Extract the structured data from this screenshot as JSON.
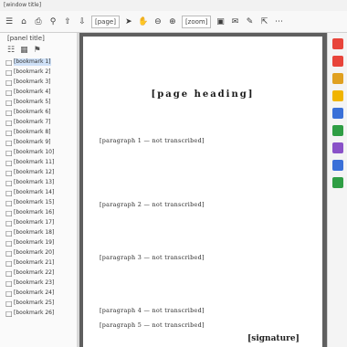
{
  "menubar": {
    "title": "[window title]"
  },
  "toolbar": {
    "page_indicator": "[page]",
    "zoom": "[zoom]",
    "icons": [
      "menu-icon",
      "home-icon",
      "print-icon",
      "search-icon",
      "page-up-icon",
      "page-down-icon",
      "select-icon",
      "hand-icon",
      "zoom-out-icon",
      "zoom-in-icon",
      "fit-icon",
      "comment-icon",
      "pen-icon",
      "share-icon",
      "more-icon"
    ]
  },
  "sidebar": {
    "header": "[panel title]",
    "items": [
      {
        "label": "[bookmark 1]"
      },
      {
        "label": "[bookmark 2]"
      },
      {
        "label": "[bookmark 3]"
      },
      {
        "label": "[bookmark 4]"
      },
      {
        "label": "[bookmark 5]"
      },
      {
        "label": "[bookmark 6]"
      },
      {
        "label": "[bookmark 7]"
      },
      {
        "label": "[bookmark 8]"
      },
      {
        "label": "[bookmark 9]"
      },
      {
        "label": "[bookmark 10]"
      },
      {
        "label": "[bookmark 11]"
      },
      {
        "label": "[bookmark 12]"
      },
      {
        "label": "[bookmark 13]"
      },
      {
        "label": "[bookmark 14]"
      },
      {
        "label": "[bookmark 15]"
      },
      {
        "label": "[bookmark 16]"
      },
      {
        "label": "[bookmark 17]"
      },
      {
        "label": "[bookmark 18]"
      },
      {
        "label": "[bookmark 19]"
      },
      {
        "label": "[bookmark 20]"
      },
      {
        "label": "[bookmark 21]"
      },
      {
        "label": "[bookmark 22]"
      },
      {
        "label": "[bookmark 23]"
      },
      {
        "label": "[bookmark 24]"
      },
      {
        "label": "[bookmark 25]"
      },
      {
        "label": "[bookmark 26]"
      }
    ]
  },
  "document": {
    "heading": "[page heading]",
    "paragraphs": [
      {
        "text": "[paragraph 1 — not transcribed]"
      },
      {
        "text": "[paragraph 2 — not transcribed]"
      },
      {
        "text": "[paragraph 3 — not transcribed]"
      },
      {
        "text": "[paragraph 4 — not transcribed]"
      },
      {
        "text": "[paragraph 5 — not transcribed]"
      }
    ],
    "signature": "[signature]"
  },
  "rightbar": {
    "icons": [
      {
        "name": "export-pdf-icon",
        "color": "#e8443a"
      },
      {
        "name": "edit-pdf-icon",
        "color": "#e8443a"
      },
      {
        "name": "create-pdf-icon",
        "color": "#e0a020"
      },
      {
        "name": "comment-tool-icon",
        "color": "#f0b400"
      },
      {
        "name": "combine-files-icon",
        "color": "#3a70d8"
      },
      {
        "name": "organize-pages-icon",
        "color": "#2f9e44"
      },
      {
        "name": "fill-sign-icon",
        "color": "#8a52c8"
      },
      {
        "name": "protect-icon",
        "color": "#3a70d8"
      },
      {
        "name": "send-icon",
        "color": "#2f9e44"
      }
    ]
  }
}
